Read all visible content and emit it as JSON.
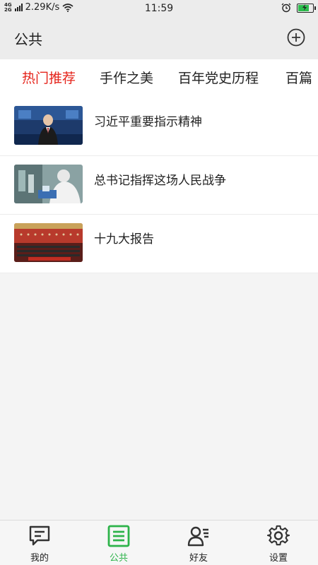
{
  "status_bar": {
    "network_top": "4G",
    "network_bottom": "2G",
    "speed": "2.29K/s",
    "time": "11:59",
    "battery_level": 0.8
  },
  "header": {
    "title": "公共",
    "add_icon": "plus-circle-icon"
  },
  "tabs": [
    {
      "label": "热门推荐",
      "active": true
    },
    {
      "label": "手作之美",
      "active": false
    },
    {
      "label": "百年党史历程",
      "active": false
    },
    {
      "label": "百篇",
      "active": false
    }
  ],
  "articles": [
    {
      "title": "习近平重要指示精神",
      "thumb_icon": "news-anchor-thumbnail"
    },
    {
      "title": "总书记指挥这场人民战争",
      "thumb_icon": "lab-worker-thumbnail"
    },
    {
      "title": "十九大报告",
      "thumb_icon": "congress-hall-thumbnail"
    }
  ],
  "bottom_nav": [
    {
      "label": "我的",
      "icon": "chat-bubble-icon",
      "active": false
    },
    {
      "label": "公共",
      "icon": "list-icon",
      "active": true
    },
    {
      "label": "好友",
      "icon": "friends-icon",
      "active": false
    },
    {
      "label": "设置",
      "icon": "gear-icon",
      "active": false
    }
  ],
  "colors": {
    "accent_red": "#e5241b",
    "accent_green": "#2db34a",
    "header_bg": "#ececec"
  }
}
